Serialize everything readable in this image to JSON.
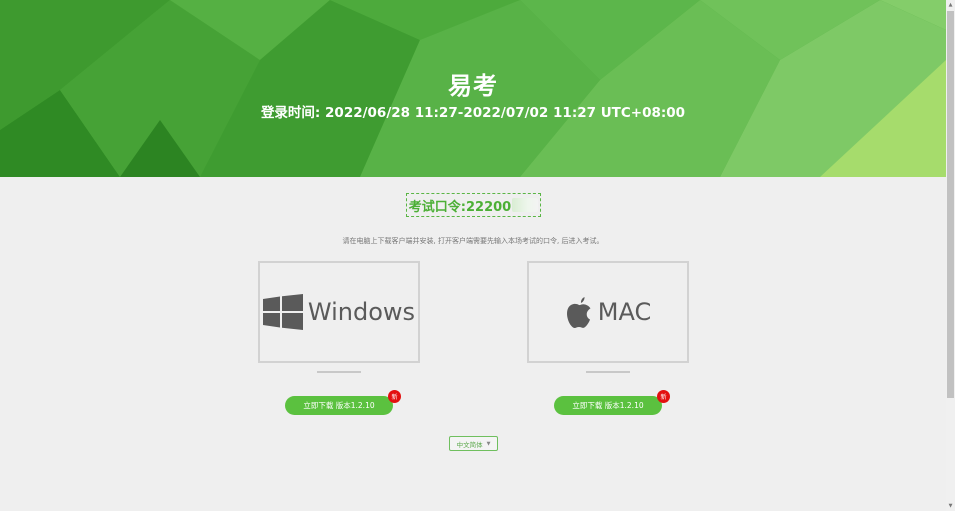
{
  "header": {
    "title": "易考",
    "login_time": "登录时间: 2022/06/28 11:27-2022/07/02 11:27 UTC+08:00"
  },
  "token": {
    "label": "考试口令:22200"
  },
  "hint": "请在电脑上下载客户端并安装, 打开客户端需要先输入本场考试的口令, 后进入考试。",
  "downloads": [
    {
      "os": "Windows",
      "icon": "windows-logo-icon",
      "button_label": "立即下载  版本1.2.10",
      "badge": "新"
    },
    {
      "os": "MAC",
      "icon": "apple-logo-icon",
      "button_label": "立即下载  版本1.2.10",
      "badge": "新"
    }
  ],
  "language": {
    "selected": "中文简体"
  },
  "colors": {
    "accent": "#5bc13f",
    "badge": "#e3100f"
  }
}
